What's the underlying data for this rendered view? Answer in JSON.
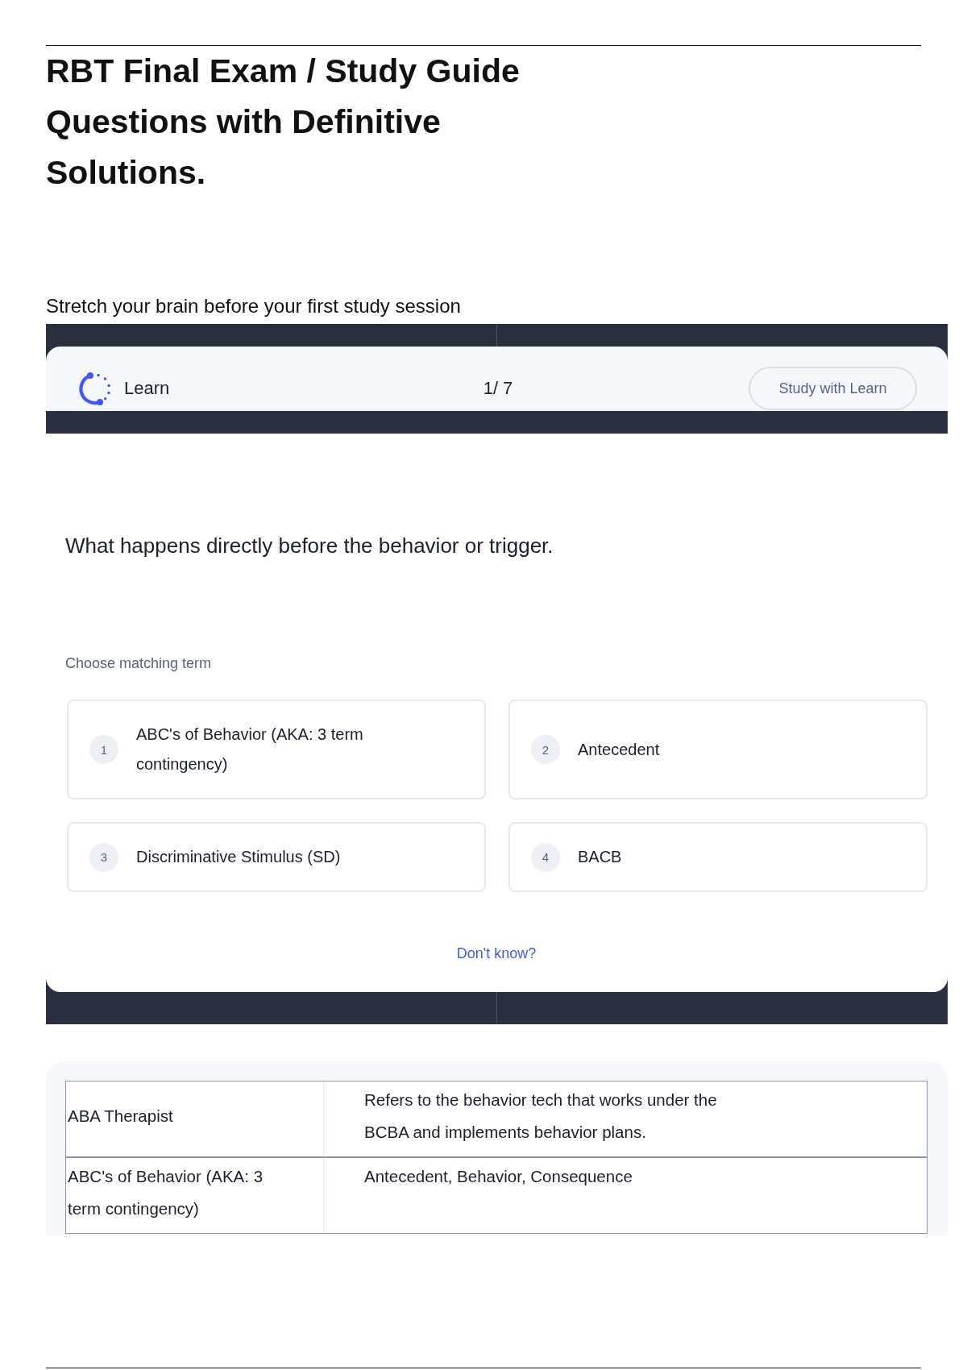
{
  "document": {
    "title": "RBT Final Exam / Study Guide Questions with Definitive Solutions.",
    "subtitle": "Stretch your brain before your first study session"
  },
  "learn_widget": {
    "header": {
      "mode_label": "Learn",
      "progress": "1/ 7",
      "study_button": "Study with Learn"
    },
    "question": "What happens directly before the behavior or trigger.",
    "prompt": "Choose matching term",
    "options": [
      {
        "number": "1",
        "label": "ABC's of Behavior (AKA: 3 term contingency)"
      },
      {
        "number": "2",
        "label": "Antecedent"
      },
      {
        "number": "3",
        "label": "Discriminative Stimulus (SD)"
      },
      {
        "number": "4",
        "label": "BACB"
      }
    ],
    "dont_know_link": "Don't know?"
  },
  "term_table": {
    "rows": [
      {
        "term": "ABA Therapist",
        "definition": "Refers to the behavior tech that works under the BCBA and implements behavior plans."
      },
      {
        "term": "ABC's of Behavior (AKA: 3 term contingency)",
        "definition": "Antecedent, Behavior, Consequence"
      }
    ]
  }
}
